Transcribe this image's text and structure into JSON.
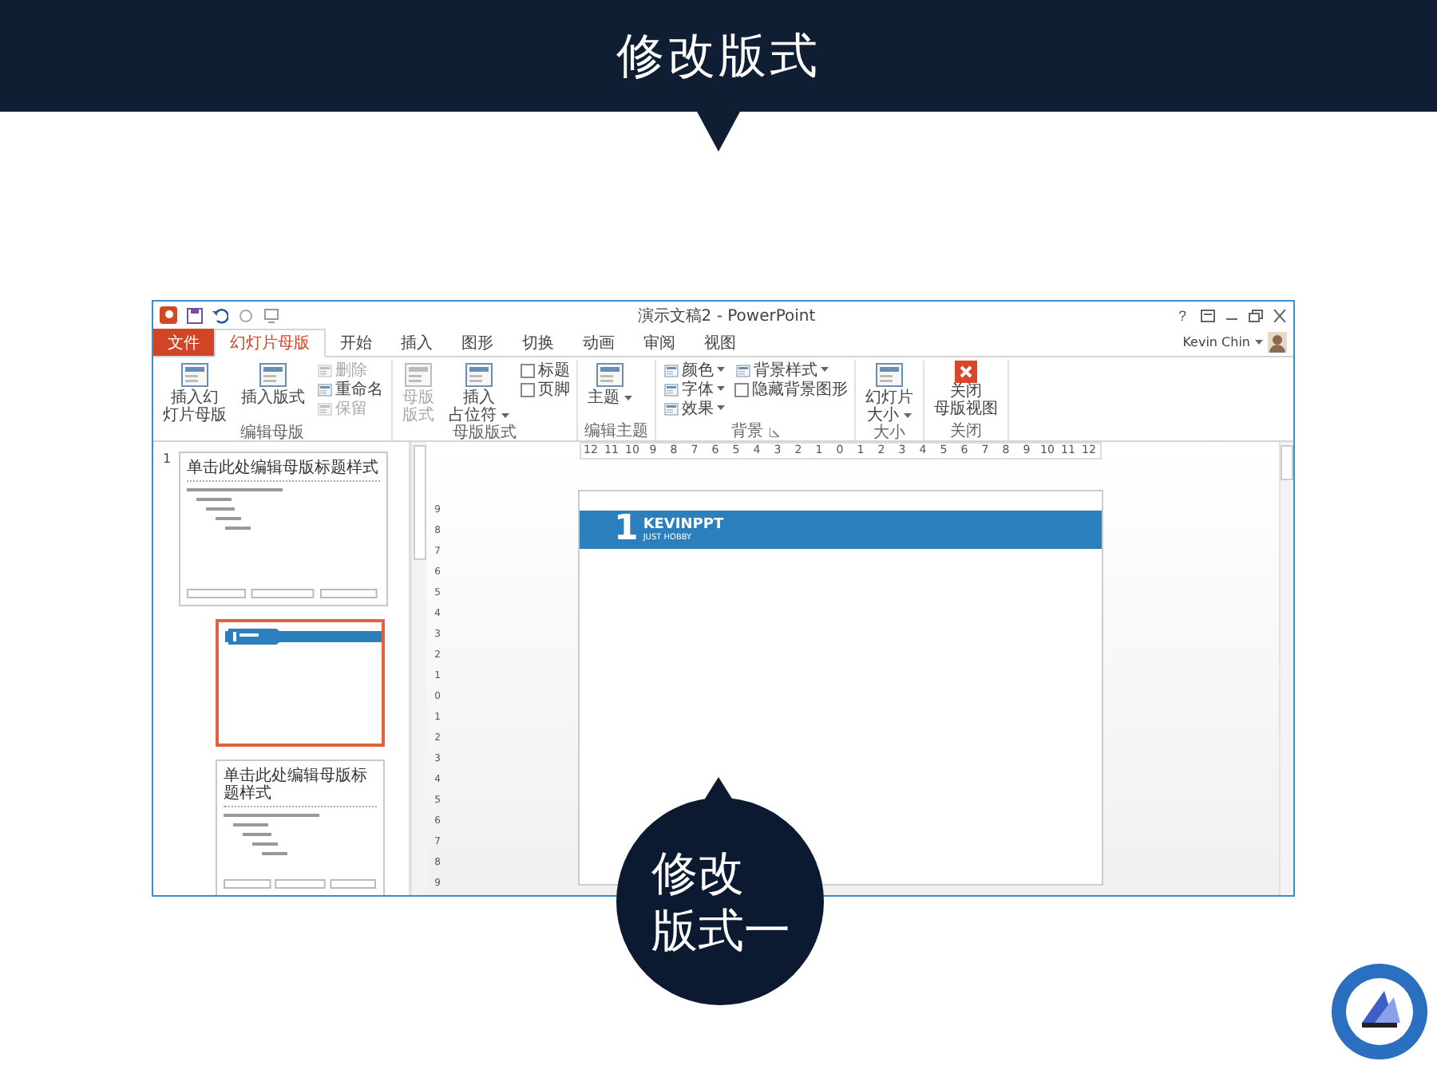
{
  "header": {
    "title": "修改版式"
  },
  "window": {
    "title": "演示文稿2 - PowerPoint",
    "help": "?",
    "user": "Kevin Chin"
  },
  "menu_tabs": [
    {
      "label": "文件",
      "kind": "file",
      "selected": false
    },
    {
      "label": "幻灯片母版",
      "kind": "tab",
      "selected": true
    },
    {
      "label": "开始",
      "kind": "tab",
      "selected": false
    },
    {
      "label": "插入",
      "kind": "tab",
      "selected": false
    },
    {
      "label": "图形",
      "kind": "tab",
      "selected": false
    },
    {
      "label": "切换",
      "kind": "tab",
      "selected": false
    },
    {
      "label": "动画",
      "kind": "tab",
      "selected": false
    },
    {
      "label": "审阅",
      "kind": "tab",
      "selected": false
    },
    {
      "label": "视图",
      "kind": "tab",
      "selected": false
    }
  ],
  "ribbon": {
    "groups": [
      {
        "label": "编辑母版",
        "launcher": false,
        "columns": [
          [
            {
              "kind": "large",
              "lines": [
                "插入幻",
                "灯片母版"
              ],
              "disabled": false,
              "dropdown": false
            }
          ],
          [
            {
              "kind": "large",
              "lines": [
                "插入版式"
              ],
              "disabled": false,
              "dropdown": false
            }
          ],
          [
            {
              "kind": "small",
              "label": "删除",
              "disabled": true,
              "dropdown": false
            },
            {
              "kind": "small",
              "label": "重命名",
              "disabled": false,
              "dropdown": false
            },
            {
              "kind": "small",
              "label": "保留",
              "disabled": true,
              "dropdown": false
            }
          ]
        ]
      },
      {
        "label": "母版版式",
        "launcher": false,
        "columns": [
          [
            {
              "kind": "large",
              "lines": [
                "母版",
                "版式"
              ],
              "disabled": true,
              "dropdown": false
            }
          ],
          [
            {
              "kind": "large",
              "lines": [
                "插入",
                "占位符"
              ],
              "disabled": false,
              "dropdown": true
            }
          ],
          [
            {
              "kind": "check",
              "label": "标题",
              "checked": false
            },
            {
              "kind": "check",
              "label": "页脚",
              "checked": false
            }
          ]
        ]
      },
      {
        "label": "编辑主题",
        "launcher": false,
        "columns": [
          [
            {
              "kind": "large",
              "lines": [
                "主题"
              ],
              "disabled": false,
              "dropdown": true
            }
          ]
        ]
      },
      {
        "label": "背景",
        "launcher": true,
        "columns": [
          [
            {
              "kind": "small",
              "label": "颜色",
              "disabled": false,
              "dropdown": true
            },
            {
              "kind": "small",
              "label": "字体",
              "disabled": false,
              "dropdown": true
            },
            {
              "kind": "small",
              "label": "效果",
              "disabled": false,
              "dropdown": true
            }
          ],
          [
            {
              "kind": "small",
              "label": "背景样式",
              "disabled": false,
              "dropdown": true
            },
            {
              "kind": "check",
              "label": "隐藏背景图形",
              "checked": false
            }
          ]
        ]
      },
      {
        "label": "大小",
        "launcher": false,
        "columns": [
          [
            {
              "kind": "large",
              "lines": [
                "幻灯片",
                "大小"
              ],
              "disabled": false,
              "dropdown": true
            }
          ]
        ]
      },
      {
        "label": "关闭",
        "launcher": false,
        "columns": [
          [
            {
              "kind": "close",
              "lines": [
                "关闭",
                "母版视图"
              ],
              "disabled": false,
              "dropdown": false
            }
          ]
        ]
      }
    ]
  },
  "thumbnails": [
    {
      "kind": "master",
      "number": "1",
      "title": "单击此处编辑母版标题样式",
      "selected": false
    },
    {
      "kind": "logo",
      "selected": true
    },
    {
      "kind": "title",
      "title": "单击此处编辑母版标题样式",
      "selected": false
    }
  ],
  "ruler": {
    "horizontal": [
      "12",
      "11",
      "10",
      "9",
      "8",
      "7",
      "6",
      "5",
      "4",
      "3",
      "2",
      "1",
      "0",
      "1",
      "2",
      "3",
      "4",
      "5",
      "6",
      "7",
      "8",
      "9",
      "10",
      "11",
      "12"
    ],
    "vertical": [
      "9",
      "8",
      "7",
      "6",
      "5",
      "4",
      "3",
      "2",
      "1",
      "0",
      "1",
      "2",
      "3",
      "4",
      "5",
      "6",
      "7",
      "8",
      "9"
    ]
  },
  "slide": {
    "numeral": "1",
    "brand": "KEVINPPT",
    "tagline": "JUST HOBBY"
  },
  "callout": {
    "lines": [
      "修改",
      "版式一"
    ]
  }
}
